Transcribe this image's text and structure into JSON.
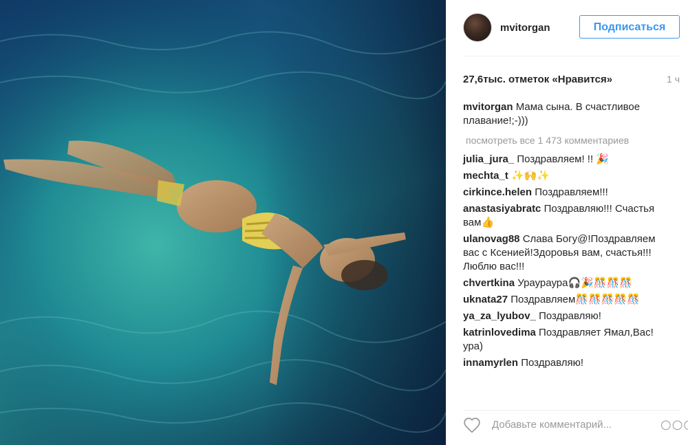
{
  "post": {
    "username": "mvitorgan",
    "follow_label": "Подписаться",
    "likes": "27,6тыс. отметок «Нравится»",
    "time": "1 ч",
    "caption": {
      "user": "mvitorgan",
      "text": "Мама сына. В счастливое плавание!;-)))"
    },
    "view_all_label": "посмотреть все 1 473 комментариев",
    "comments": [
      {
        "user": "julia_jura_",
        "text": "Поздравляем! !! 🎉"
      },
      {
        "user": "mechta_t",
        "text": "✨🙌✨"
      },
      {
        "user": "cirkince.helen",
        "text": "Поздравляем!!!"
      },
      {
        "user": "anastasiyabratc",
        "text": "Поздравляю!!! Счастья вам👍"
      },
      {
        "user": "ulanovag88",
        "text": "Слава Богу@!Поздравляем вас с Ксенией!Здоровья вам, счастья!!!Люблю вас!!!"
      },
      {
        "user": "chvertkina",
        "text": "Ураураура🎧🎉🎊🎊🎊"
      },
      {
        "user": "uknata27",
        "text": "Поздравляем🎊🎊🎊🎊🎊"
      },
      {
        "user": "ya_za_lyubov_",
        "text": "Поздравляю!"
      },
      {
        "user": "katrinlovedima",
        "text": "Поздравляет Ямал,Вас!ура)"
      },
      {
        "user": "innamyrlen",
        "text": "Поздравляю!"
      }
    ],
    "add_comment_placeholder": "Добавьте комментарий...",
    "more_label": "○○○"
  },
  "icons": {
    "like": "heart-outline-icon",
    "more": "more-options-icon"
  },
  "colors": {
    "accent": "#3897f0",
    "text": "#262626",
    "muted": "#999999",
    "border": "#efefef"
  }
}
